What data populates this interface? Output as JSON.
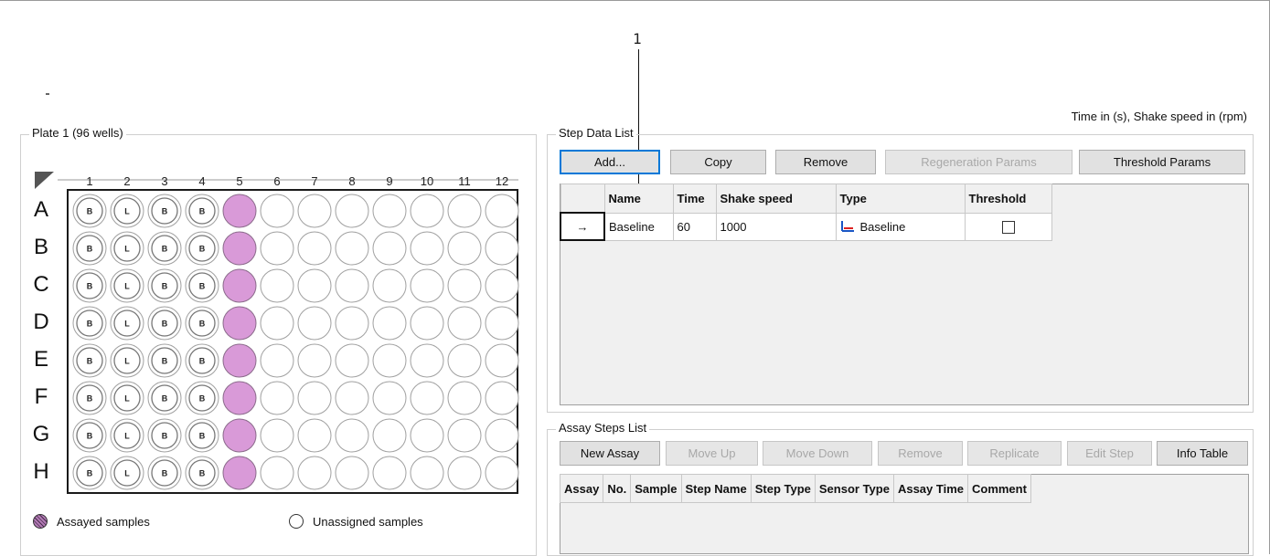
{
  "callout": {
    "number": "1"
  },
  "plate": {
    "title": "Plate 1 (96 wells)",
    "columns": [
      "1",
      "2",
      "3",
      "4",
      "5",
      "6",
      "7",
      "8",
      "9",
      "10",
      "11",
      "12"
    ],
    "rows": [
      "A",
      "B",
      "C",
      "D",
      "E",
      "F",
      "G",
      "H"
    ],
    "well_labels": [
      "B",
      "L",
      "B",
      "B"
    ],
    "colors": {
      "assayed": "#d99ad8",
      "well_border": "#a0a0a0",
      "plate_border": "#1a1a1a"
    },
    "legend": {
      "assayed": "Assayed samples",
      "unassigned": "Unassigned samples"
    }
  },
  "units_note": "Time in (s), Shake speed in (rpm)",
  "step_data_list": {
    "title": "Step Data List",
    "buttons": {
      "add": "Add...",
      "copy": "Copy",
      "remove": "Remove",
      "regeneration": "Regeneration Params",
      "threshold": "Threshold Params"
    },
    "columns": [
      "Name",
      "Time",
      "Shake speed",
      "Type",
      "Threshold"
    ],
    "rows": [
      {
        "indicator": "→",
        "name": "Baseline",
        "time": "60",
        "shake_speed": "1000",
        "type": "Baseline",
        "threshold": false
      }
    ]
  },
  "assay_steps_list": {
    "title": "Assay Steps List",
    "buttons": {
      "new_assay": "New Assay",
      "move_up": "Move Up",
      "move_down": "Move Down",
      "remove": "Remove",
      "replicate": "Replicate",
      "edit_step": "Edit Step",
      "info_table": "Info Table"
    },
    "columns": [
      "Assay",
      "No.",
      "Sample",
      "Step Name",
      "Step Type",
      "Sensor Type",
      "Assay Time",
      "Comment"
    ]
  }
}
